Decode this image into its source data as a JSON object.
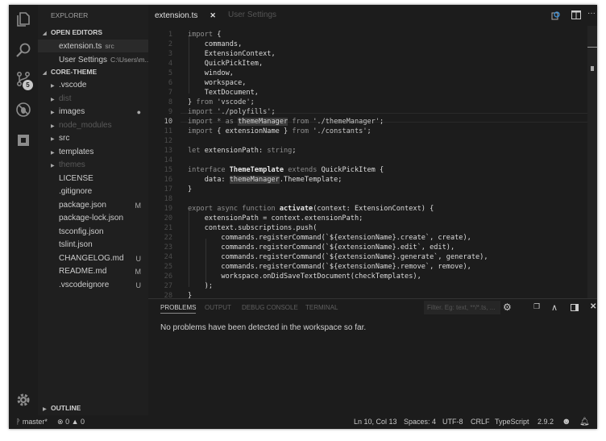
{
  "sidebar": {
    "title": "EXPLORER",
    "open_editors": "OPEN EDITORS",
    "open_files": [
      {
        "name": "extension.ts",
        "desc": "src"
      },
      {
        "name": "User Settings",
        "desc": "C:\\Users\\m..."
      }
    ],
    "project": "CORE-THEME",
    "tree": [
      {
        "name": ".vscode",
        "folder": true,
        "dim": false,
        "git": ""
      },
      {
        "name": "dist",
        "folder": true,
        "dim": true,
        "git": ""
      },
      {
        "name": "images",
        "folder": true,
        "dim": false,
        "git": "●"
      },
      {
        "name": "node_modules",
        "folder": true,
        "dim": true,
        "git": ""
      },
      {
        "name": "src",
        "folder": true,
        "dim": false,
        "git": ""
      },
      {
        "name": "templates",
        "folder": true,
        "dim": false,
        "git": ""
      },
      {
        "name": "themes",
        "folder": true,
        "dim": true,
        "git": ""
      },
      {
        "name": "LICENSE",
        "folder": false,
        "dim": false,
        "git": ""
      },
      {
        "name": ".gitignore",
        "folder": false,
        "dim": false,
        "git": ""
      },
      {
        "name": "package.json",
        "folder": false,
        "dim": false,
        "git": "M"
      },
      {
        "name": "package-lock.json",
        "folder": false,
        "dim": false,
        "git": ""
      },
      {
        "name": "tsconfig.json",
        "folder": false,
        "dim": false,
        "git": ""
      },
      {
        "name": "tslint.json",
        "folder": false,
        "dim": false,
        "git": ""
      },
      {
        "name": "CHANGELOG.md",
        "folder": false,
        "dim": false,
        "git": "U"
      },
      {
        "name": "README.md",
        "folder": false,
        "dim": false,
        "git": "M"
      },
      {
        "name": ".vscodeignore",
        "folder": false,
        "dim": false,
        "git": "U"
      }
    ],
    "outline": "OUTLINE"
  },
  "activity": {
    "scm_badge": "5",
    "icons": [
      "files-icon",
      "search-icon",
      "source-control-icon",
      "debug-icon",
      "extensions-icon",
      "gear-icon"
    ]
  },
  "tabs": [
    {
      "label": "extension.ts",
      "active": true,
      "close": "✕"
    },
    {
      "label": "User Settings",
      "active": false
    }
  ],
  "editor": {
    "current_line": 10,
    "lines": [
      [
        [
          "kw",
          "import"
        ],
        [
          "id",
          " {"
        ]
      ],
      [
        [
          "id",
          "    commands,"
        ]
      ],
      [
        [
          "id",
          "    ExtensionContext,"
        ]
      ],
      [
        [
          "id",
          "    QuickPickItem,"
        ]
      ],
      [
        [
          "id",
          "    window,"
        ]
      ],
      [
        [
          "id",
          "    workspace,"
        ]
      ],
      [
        [
          "id",
          "    TextDocument,"
        ]
      ],
      [
        [
          "id",
          "} "
        ],
        [
          "kw",
          "from"
        ],
        [
          "st",
          " 'vscode'"
        ],
        [
          "id",
          ";"
        ]
      ],
      [
        [
          "kw",
          "import"
        ],
        [
          "st",
          " './polyfills'"
        ],
        [
          "id",
          ";"
        ]
      ],
      [
        [
          "kw",
          "import * as "
        ],
        [
          "hl",
          "themeManager"
        ],
        [
          "kw",
          " from "
        ],
        [
          "st",
          "'./themeManager'"
        ],
        [
          "id",
          ";"
        ]
      ],
      [
        [
          "kw",
          "import"
        ],
        [
          "id",
          " { extensionName } "
        ],
        [
          "kw",
          "from"
        ],
        [
          "st",
          " './constants'"
        ],
        [
          "id",
          ";"
        ]
      ],
      [],
      [
        [
          "kw",
          "let "
        ],
        [
          "id",
          "extensionPath: "
        ],
        [
          "kw",
          "string"
        ],
        [
          "id",
          ";"
        ]
      ],
      [],
      [
        [
          "kw",
          "interface "
        ],
        [
          "b",
          "ThemeTemplate"
        ],
        [
          "kw",
          " extends "
        ],
        [
          "id",
          "QuickPickItem {"
        ]
      ],
      [
        [
          "id",
          "    data: "
        ],
        [
          "hl",
          "themeManager"
        ],
        [
          "id",
          ".ThemeTemplate;"
        ]
      ],
      [
        [
          "id",
          "}"
        ]
      ],
      [],
      [
        [
          "kw",
          "export async function "
        ],
        [
          "b",
          "activate"
        ],
        [
          "id",
          "(context: ExtensionContext) {"
        ]
      ],
      [
        [
          "id",
          "    extensionPath = context.extensionPath;"
        ]
      ],
      [
        [
          "id",
          "    context.subscriptions.push("
        ]
      ],
      [
        [
          "id",
          "        commands.registerCommand(`${extensionName}.create`, create),"
        ]
      ],
      [
        [
          "id",
          "        commands.registerCommand(`${extensionName}.edit`, edit),"
        ]
      ],
      [
        [
          "id",
          "        commands.registerCommand(`${extensionName}.generate`, generate),"
        ]
      ],
      [
        [
          "id",
          "        commands.registerCommand(`${extensionName}.remove`, remove),"
        ]
      ],
      [
        [
          "id",
          "        workspace.onDidSaveTextDocument(checkTemplates),"
        ]
      ],
      [
        [
          "id",
          "    );"
        ]
      ],
      [
        [
          "id",
          "}"
        ]
      ]
    ]
  },
  "panel": {
    "tabs": [
      "PROBLEMS",
      "OUTPUT",
      "DEBUG CONSOLE",
      "TERMINAL"
    ],
    "filter_placeholder": "Filter. Eg: text, **/*.ts, ...",
    "message": "No problems have been detected in the workspace so far."
  },
  "status": {
    "branch": "master*",
    "errors": "0",
    "warnings": "0",
    "position": "Ln 10, Col 13",
    "spaces": "Spaces: 4",
    "encoding": "UTF-8",
    "eol": "CRLF",
    "language": "TypeScript",
    "version": "2.9.2"
  }
}
